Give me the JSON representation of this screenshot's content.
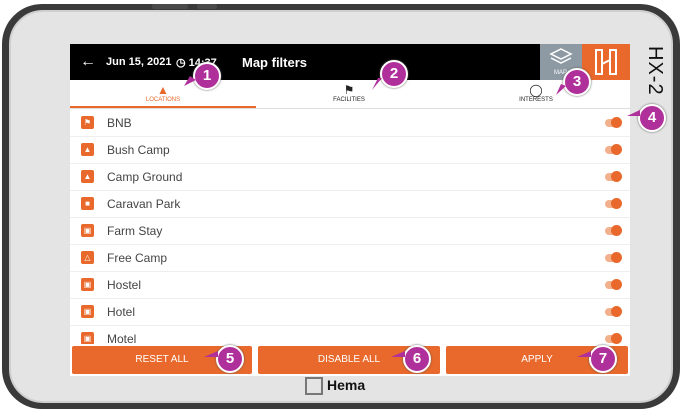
{
  "device": {
    "side_brand": "HX-2",
    "bottom_brand": "Hema"
  },
  "topbar": {
    "back_icon": "back-arrow-icon",
    "date": "Jun 15, 2021",
    "time": "14:37",
    "title": "Map filters",
    "layers_label": "MAP"
  },
  "tabs": [
    {
      "label": "LOCATIONS",
      "icon": "tent-icon",
      "active": true
    },
    {
      "label": "FACILITIES",
      "icon": "facilities-icon",
      "active": false
    },
    {
      "label": "INTERESTS",
      "icon": "bicycle-icon",
      "active": false
    }
  ],
  "items": [
    {
      "label": "BNB",
      "icon": "bnb-icon",
      "enabled": true
    },
    {
      "label": "Bush Camp",
      "icon": "bush-camp-icon",
      "enabled": true
    },
    {
      "label": "Camp Ground",
      "icon": "camp-ground-icon",
      "enabled": true
    },
    {
      "label": "Caravan Park",
      "icon": "caravan-icon",
      "enabled": true
    },
    {
      "label": "Farm Stay",
      "icon": "farm-stay-icon",
      "enabled": true
    },
    {
      "label": "Free Camp",
      "icon": "free-camp-icon",
      "enabled": true
    },
    {
      "label": "Hostel",
      "icon": "hostel-icon",
      "enabled": true
    },
    {
      "label": "Hotel",
      "icon": "hotel-icon",
      "enabled": true
    },
    {
      "label": "Motel",
      "icon": "motel-icon",
      "enabled": true
    }
  ],
  "footer": {
    "reset_label": "RESET ALL",
    "disable_label": "DISABLE ALL",
    "apply_label": "APPLY"
  },
  "callouts": [
    "1",
    "2",
    "3",
    "4",
    "5",
    "6",
    "7"
  ],
  "colors": {
    "accent": "#e8692b",
    "callout": "#b0309b",
    "topbar": "#000000"
  }
}
